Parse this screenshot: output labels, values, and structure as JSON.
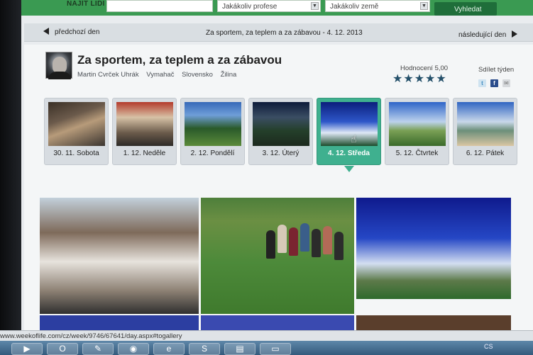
{
  "topbar": {
    "find_label": "NAJÍT LIDI",
    "profession_select": "Jakákoliv profese",
    "country_select": "Jakákoliv země",
    "search_button": "Vyhledat"
  },
  "daynav": {
    "prev_label": "předchozí den",
    "center_label": "Za sportem, za teplem a za zábavou - 4. 12. 2013",
    "next_label": "následující den"
  },
  "header": {
    "title": "Za sportem, za teplem a za zábavou",
    "author": "Martin Cvrček Uhrák",
    "profession": "Vymahač",
    "country": "Slovensko",
    "city": "Žilina",
    "rating_label": "Hodnocení 5,00",
    "rating_value": 5,
    "rating_stars": "★★★★★",
    "share_label": "Sdílet týden"
  },
  "days": [
    {
      "label": "30. 11. Sobota",
      "active": false
    },
    {
      "label": "1. 12. Neděle",
      "active": false
    },
    {
      "label": "2. 12. Pondělí",
      "active": false
    },
    {
      "label": "3. 12. Úterý",
      "active": false
    },
    {
      "label": "4. 12. Středa",
      "active": true
    },
    {
      "label": "5. 12. Čtvrtek",
      "active": false
    },
    {
      "label": "6. 12. Pátek",
      "active": false
    }
  ],
  "statusbar": {
    "url": "www.weekoflife.com/cz/week/9746/67641/day.aspx#togallery"
  },
  "tray": {
    "lang": "CS"
  },
  "colors": {
    "brand_green": "#3a9a52",
    "active_day": "#3fb08f",
    "star": "#24506a"
  }
}
